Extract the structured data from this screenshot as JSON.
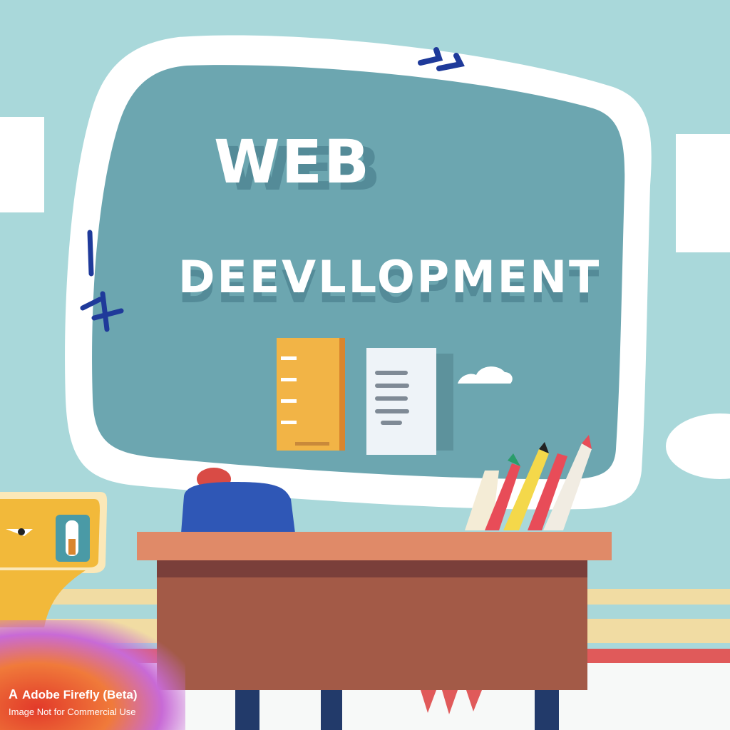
{
  "poster": {
    "title_line1": "WEB",
    "title_line2": "DEEVLLOPMENT"
  },
  "watermark": {
    "logo_text": "A",
    "line1": "Adobe Firefly (Beta)",
    "line2": "Image Not for Commercial Use"
  },
  "colors": {
    "background": "#a9d8da",
    "board": "#6ca6b0",
    "board_frame": "#ffffff",
    "desk_top": "#e08a68",
    "desk_body": "#a35a47",
    "book": "#f2b446",
    "chair": "#2f57b6",
    "stripe_yellow": "#f1dca3",
    "stripe_red": "#e05a5a"
  },
  "icons": [
    "book-icon",
    "document-icon",
    "cloud-icon",
    "pencil-cup-icon",
    "chair-icon",
    "desk-icon",
    "printer-icon"
  ]
}
